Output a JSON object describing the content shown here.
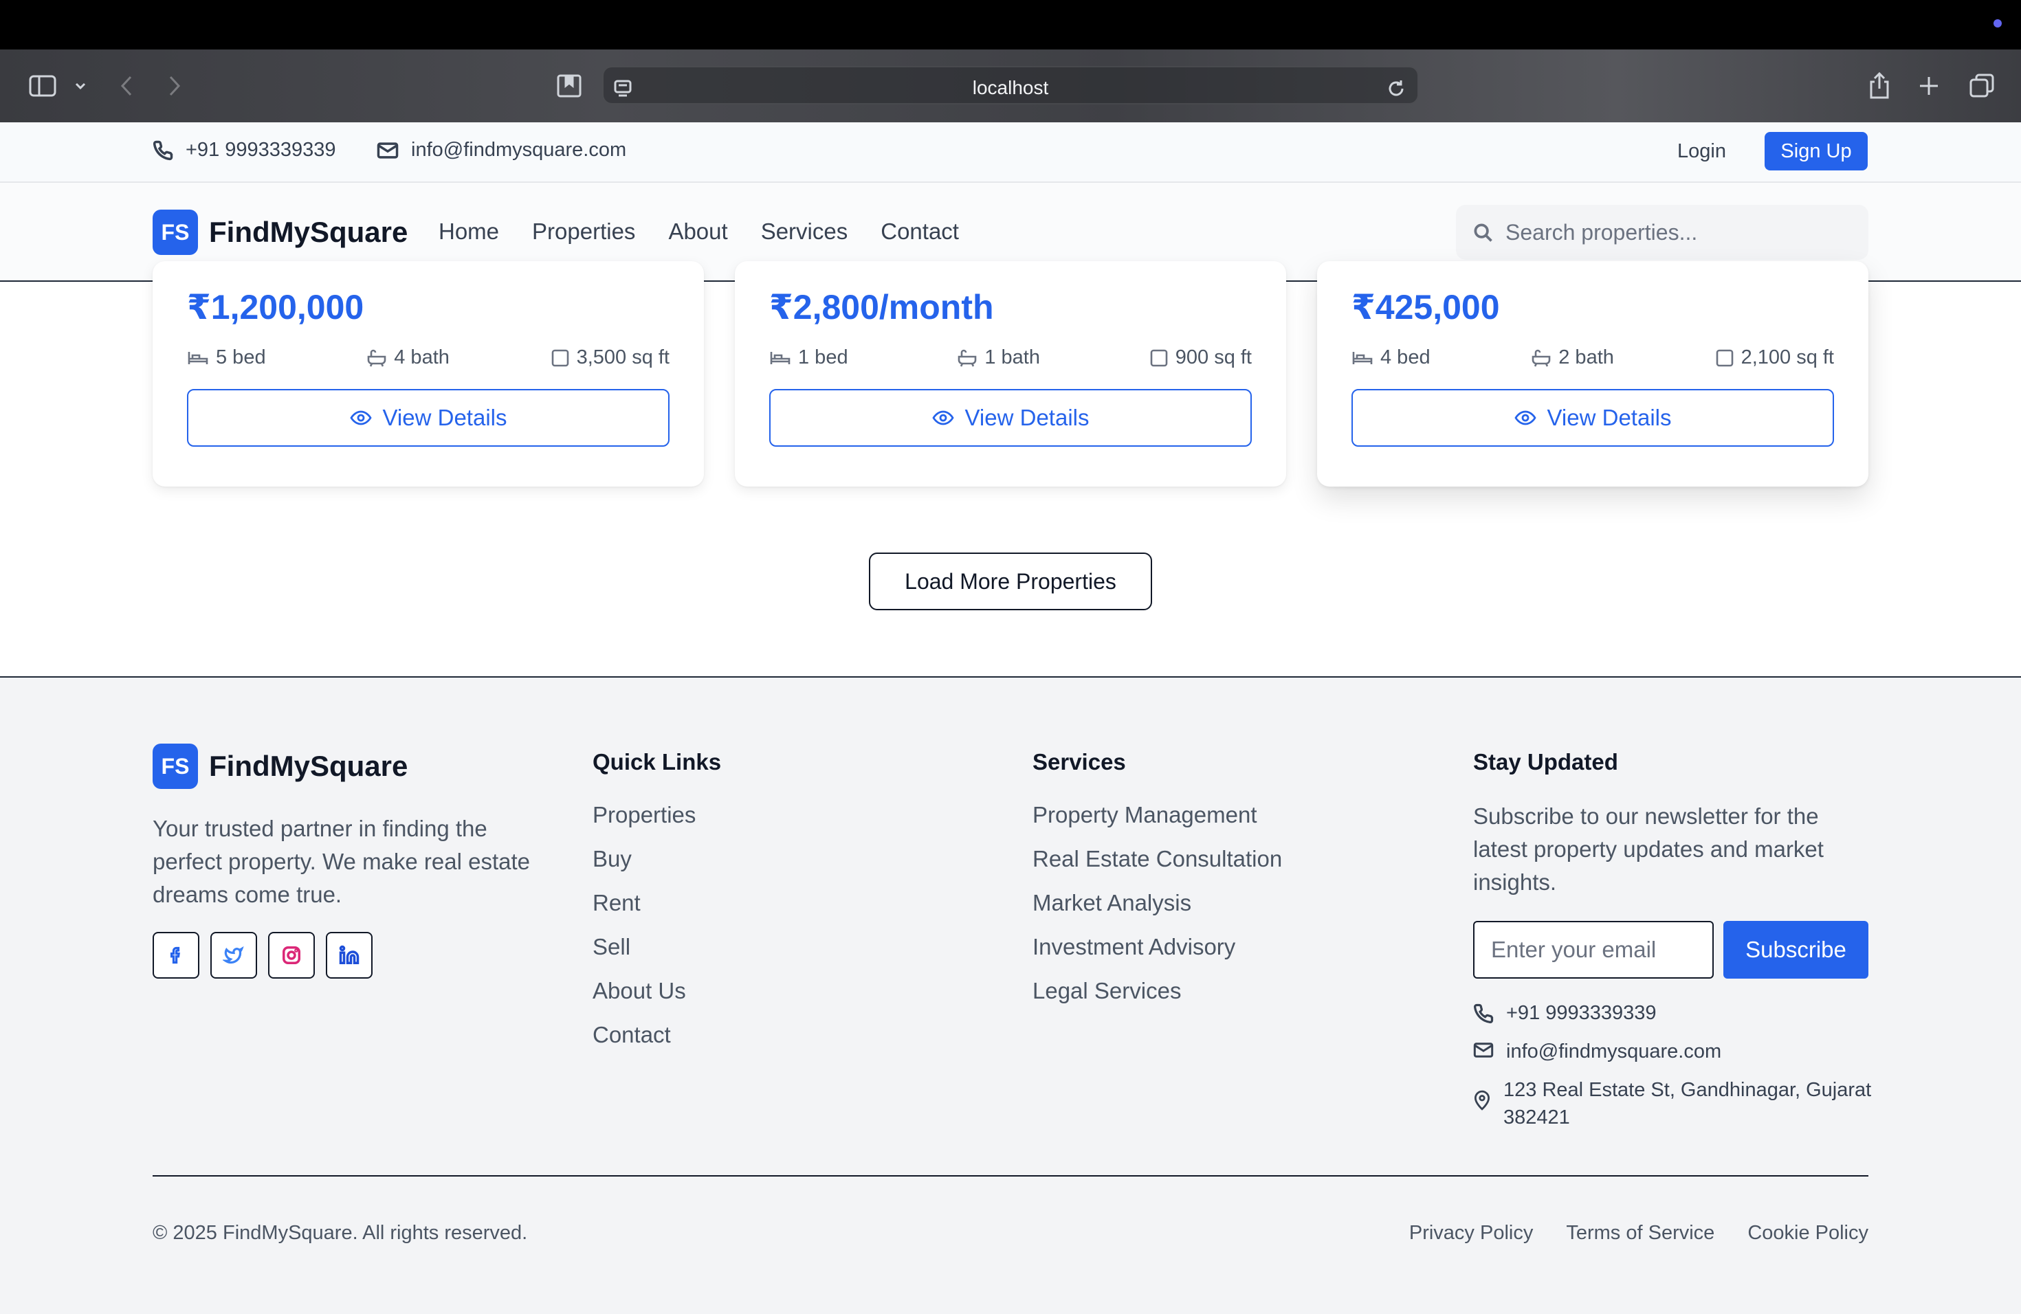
{
  "browser": {
    "url": "localhost"
  },
  "topbar": {
    "phone": "+91 9993339339",
    "email": "info@findmysquare.com",
    "login_label": "Login",
    "signup_label": "Sign Up"
  },
  "brand": {
    "badge": "FS",
    "name": "FindMySquare"
  },
  "nav": {
    "links": [
      "Home",
      "Properties",
      "About",
      "Services",
      "Contact"
    ],
    "search_placeholder": "Search properties..."
  },
  "properties": [
    {
      "price": "₹1,200,000",
      "beds": "5 bed",
      "baths": "4 bath",
      "area": "3,500 sq ft",
      "button": "View Details"
    },
    {
      "price": "₹2,800/month",
      "beds": "1 bed",
      "baths": "1 bath",
      "area": "900 sq ft",
      "button": "View Details"
    },
    {
      "price": "₹425,000",
      "beds": "4 bed",
      "baths": "2 bath",
      "area": "2,100 sq ft",
      "button": "View Details"
    }
  ],
  "load_more_label": "Load More Properties",
  "footer": {
    "about_text": "Your trusted partner in finding the perfect property. We make real estate dreams come true.",
    "socials": [
      "facebook-icon",
      "twitter-icon",
      "instagram-icon",
      "linkedin-icon"
    ],
    "quick_links": {
      "heading": "Quick Links",
      "items": [
        "Properties",
        "Buy",
        "Rent",
        "Sell",
        "About Us",
        "Contact"
      ]
    },
    "services": {
      "heading": "Services",
      "items": [
        "Property Management",
        "Real Estate Consultation",
        "Market Analysis",
        "Investment Advisory",
        "Legal Services"
      ]
    },
    "newsletter": {
      "heading": "Stay Updated",
      "text": "Subscribe to our newsletter for the latest property updates and market insights.",
      "email_placeholder": "Enter your email",
      "subscribe_label": "Subscribe"
    },
    "contact": {
      "phone": "+91 9993339339",
      "email": "info@findmysquare.com",
      "address": "123 Real Estate St, Gandhinagar, Gujarat 382421"
    },
    "copyright": "© 2025 FindMySquare. All rights reserved.",
    "legal_links": [
      "Privacy Policy",
      "Terms of Service",
      "Cookie Policy"
    ]
  },
  "colors": {
    "accent": "#2563eb",
    "text": "#1f2937",
    "footer_bg": "#f3f4f6"
  }
}
